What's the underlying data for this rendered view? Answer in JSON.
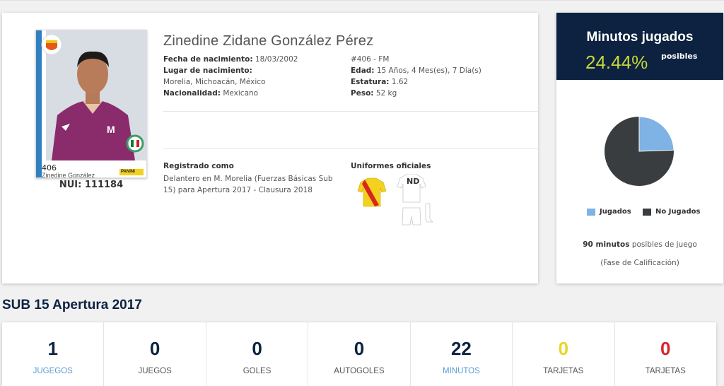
{
  "player": {
    "name": "Zinedine Zidane González Pérez",
    "sticker_number": "406",
    "sticker_name": "Zinedine González",
    "sticker_brand": "PANINI",
    "nui": "NUI: 111184",
    "birthdate_label": "Fecha de nacimiento:",
    "birthdate": "18/03/2002",
    "birthplace_label": "Lugar de nacimiento:",
    "birthplace": "Morelia, Michoacán, México",
    "nationality_label": "Nacionalidad:",
    "nationality": "Mexicano",
    "code": "#406 - FM",
    "age_label": "Edad:",
    "age": "15 Años, 4 Mes(es), 7 Día(s)",
    "height_label": "Estatura:",
    "height": "1.62",
    "weight_label": "Peso:",
    "weight": "52 kg",
    "registered_title": "Registrado como",
    "registered_text": "Delantero en M. Morelia (Fuerzas Básicas Sub 15) para Apertura 2017 - Clausura 2018",
    "uniforms_title": "Uniformes oficiales",
    "uniform_away_text": "ND"
  },
  "minutes": {
    "title": "Minutos jugados",
    "percent": "24.44%",
    "posibles": "posibles",
    "played_fraction": 0.2444,
    "legend_played": "Jugados",
    "legend_not_played": "No Jugados",
    "note_minutes": "90 minutos",
    "note_text": "posibles de juego",
    "phase": "(Fase de Calificación)",
    "color_played": "#7fb2e5",
    "color_not_played": "#3a3d40"
  },
  "section_title": "SUB 15 Apertura 2017",
  "stats": [
    {
      "value": "1",
      "label": "JUGEGOS",
      "color": "#0c2240",
      "label_color": "#5b9bd5"
    },
    {
      "value": "0",
      "label": "JUEGOS",
      "color": "#0c2240",
      "label_color": "#555555"
    },
    {
      "value": "0",
      "label": "GOLES",
      "color": "#0c2240",
      "label_color": "#555555"
    },
    {
      "value": "0",
      "label": "AUTOGOLES",
      "color": "#0c2240",
      "label_color": "#555555"
    },
    {
      "value": "22",
      "label": "MINUTOS",
      "color": "#0c2240",
      "label_color": "#5b9bd5"
    },
    {
      "value": "0",
      "label": "TARJETAS",
      "color": "#e8d62a",
      "label_color": "#555555"
    },
    {
      "value": "0",
      "label": "TARJETAS",
      "color": "#d9262b",
      "label_color": "#555555"
    }
  ]
}
